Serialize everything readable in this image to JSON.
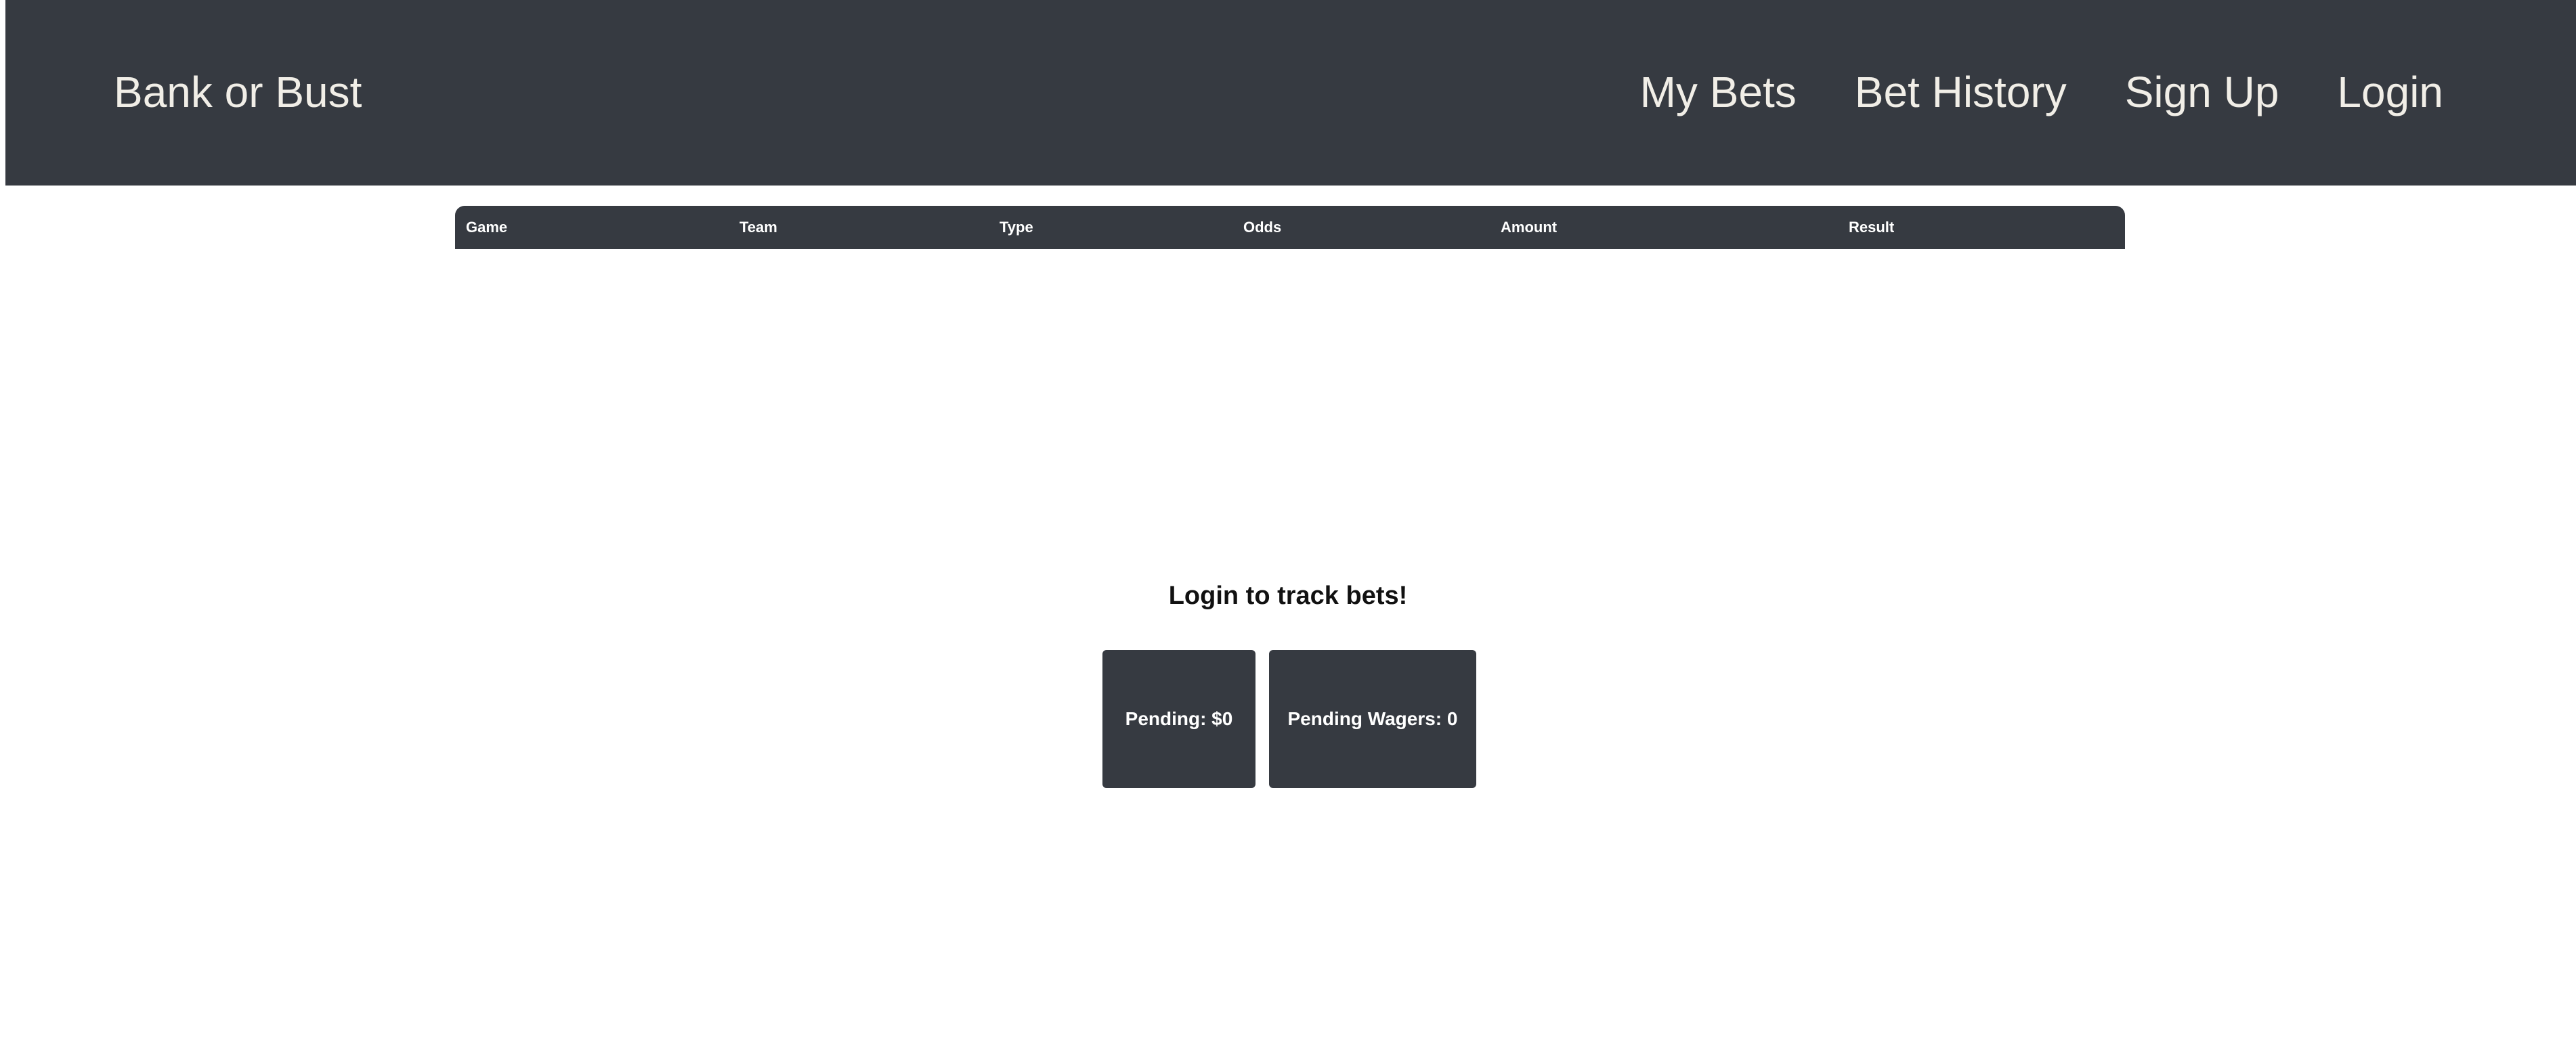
{
  "navbar": {
    "brand": "Bank or Bust",
    "links": [
      {
        "label": "My Bets"
      },
      {
        "label": "Bet History"
      },
      {
        "label": "Sign Up"
      },
      {
        "label": "Login"
      }
    ]
  },
  "table": {
    "headers": [
      "Game",
      "Team",
      "Type",
      "Odds",
      "Amount",
      "Result"
    ],
    "rows": []
  },
  "message": "Login to track bets!",
  "summary": {
    "pending": "Pending: $0",
    "pending_wagers": "Pending Wagers: 0"
  },
  "colors": {
    "navbar": "#363a41",
    "navbar_text": "#f1eee7",
    "card": "#363a41",
    "card_text": "#ffffff"
  }
}
